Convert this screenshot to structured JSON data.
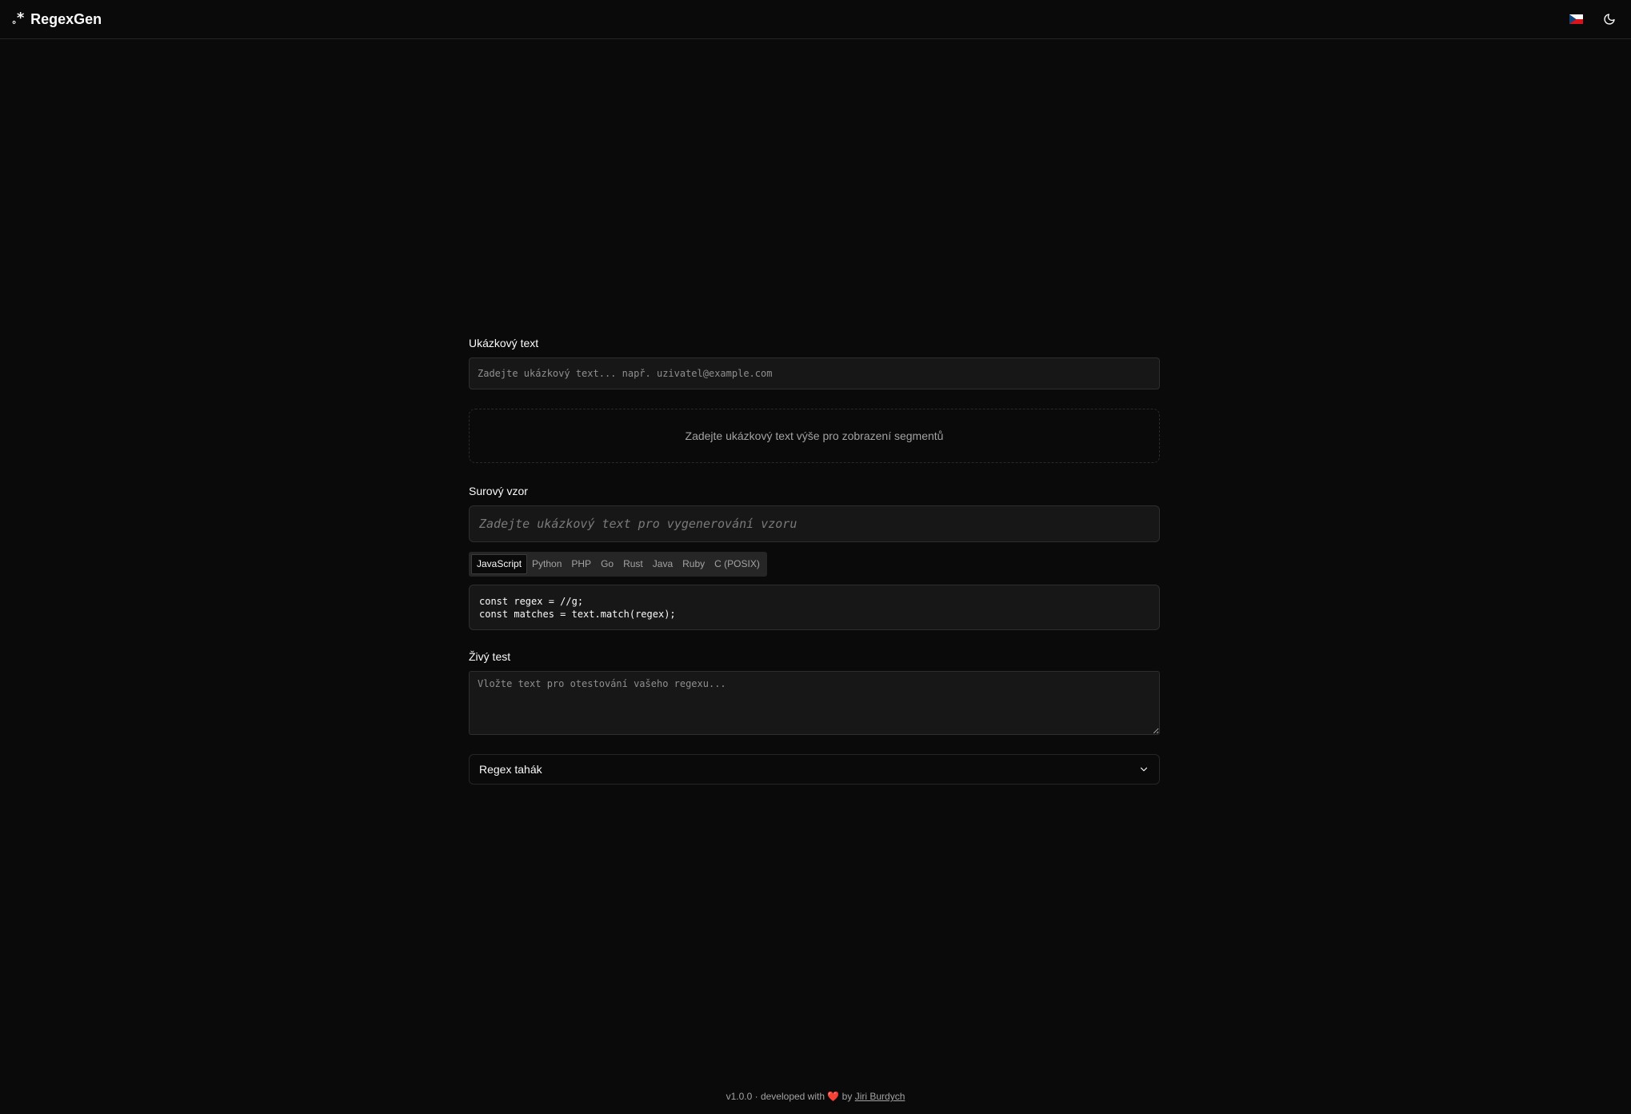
{
  "header": {
    "brand_icon": "brand-regex-icon",
    "brand_name": "RegexGen",
    "language_flag": "cz-flag-icon",
    "theme_toggle": "moon-icon"
  },
  "sample": {
    "label": "Ukázkový text",
    "placeholder": "Zadejte ukázkový text... např. uzivatel@example.com",
    "value": ""
  },
  "segments": {
    "empty_text": "Zadejte ukázkový text výše pro zobrazení segmentů"
  },
  "pattern": {
    "label": "Surový vzor",
    "placeholder": "Zadejte ukázkový text pro vygenerování vzoru",
    "value": ""
  },
  "languages": {
    "selected": "JavaScript",
    "tabs": [
      "JavaScript",
      "Python",
      "PHP",
      "Go",
      "Rust",
      "Java",
      "Ruby",
      "C (POSIX)"
    ]
  },
  "code": {
    "line1": "const regex = //g;",
    "line2": "const matches = text.match(regex);"
  },
  "live_test": {
    "label": "Živý test",
    "placeholder": "Vložte text pro otestování vašeho regexu...",
    "value": ""
  },
  "cheatsheet": {
    "title": "Regex tahák",
    "expanded": false
  },
  "footer": {
    "prefix": "v1.0.0 · developed with",
    "heart": "❤️",
    "by": "by",
    "author": "Jiri Burdych"
  },
  "colors": {
    "background": "#0a0a0a",
    "surface": "#171717",
    "border": "#2e2e2e",
    "text": "#fafafa",
    "muted": "#a3a3a3"
  }
}
